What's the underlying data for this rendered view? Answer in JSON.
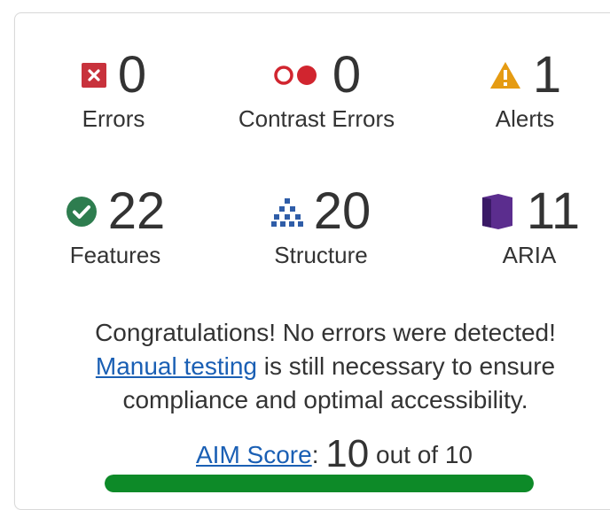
{
  "stats": {
    "errors": {
      "count": "0",
      "label": "Errors",
      "icon": "error-x-icon",
      "color": "#c8323c"
    },
    "contrast": {
      "count": "0",
      "label": "Contrast Errors",
      "icon": "contrast-dots-icon",
      "color": "#d1252f"
    },
    "alerts": {
      "count": "1",
      "label": "Alerts",
      "icon": "warning-triangle-icon",
      "color": "#e59b12"
    },
    "features": {
      "count": "22",
      "label": "Features",
      "icon": "check-circle-icon",
      "color": "#2e7d4f"
    },
    "structure": {
      "count": "20",
      "label": "Structure",
      "icon": "hierarchy-icon",
      "color": "#2f5da8"
    },
    "aria": {
      "count": "11",
      "label": "ARIA",
      "icon": "aria-box-icon",
      "color": "#5b2d8e"
    }
  },
  "message": {
    "line1": "Congratulations! No errors were detected!",
    "link_text": "Manual testing",
    "line2_rest": " is still necessary to ensure",
    "line3": "compliance and optimal accessibility."
  },
  "score": {
    "link_text": "AIM Score",
    "separator": ":",
    "value": "10",
    "suffix": "out of 10",
    "fraction": 1.0
  }
}
